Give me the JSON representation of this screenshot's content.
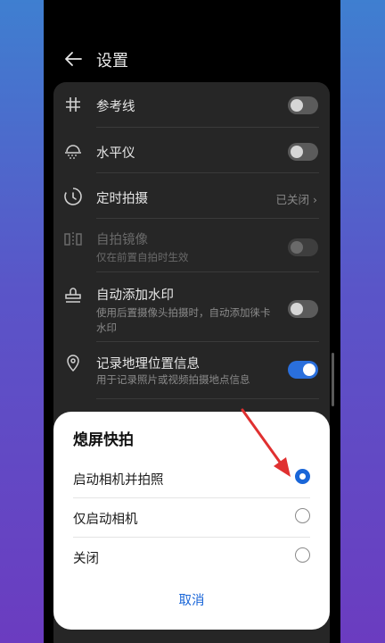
{
  "header": {
    "title": "设置"
  },
  "settings": [
    {
      "label": "参考线",
      "icon": "grid-icon",
      "toggle": "off"
    },
    {
      "label": "水平仪",
      "icon": "level-icon",
      "toggle": "off"
    },
    {
      "label": "定时拍摄",
      "icon": "timer-icon",
      "value": "已关闭"
    },
    {
      "label": "自拍镜像",
      "icon": "mirror-icon",
      "sub": "仅在前置自拍时生效",
      "toggle": "disabled"
    },
    {
      "label": "自动添加水印",
      "icon": "stamp-icon",
      "sub": "使用后置摄像头拍摄时，自动添加徕卡水印",
      "toggle": "off"
    },
    {
      "label": "记录地理位置信息",
      "icon": "location-icon",
      "sub": "用于记录照片或视频拍摄地点信息",
      "toggle": "on"
    }
  ],
  "sheet": {
    "title": "熄屏快拍",
    "options": [
      {
        "label": "启动相机并拍照",
        "selected": true
      },
      {
        "label": "仅启动相机",
        "selected": false
      },
      {
        "label": "关闭",
        "selected": false
      }
    ],
    "cancel": "取消"
  },
  "colors": {
    "accent": "#1a66d8",
    "toggle_on": "#2a6fdc",
    "annotation_arrow": "#e03030"
  }
}
